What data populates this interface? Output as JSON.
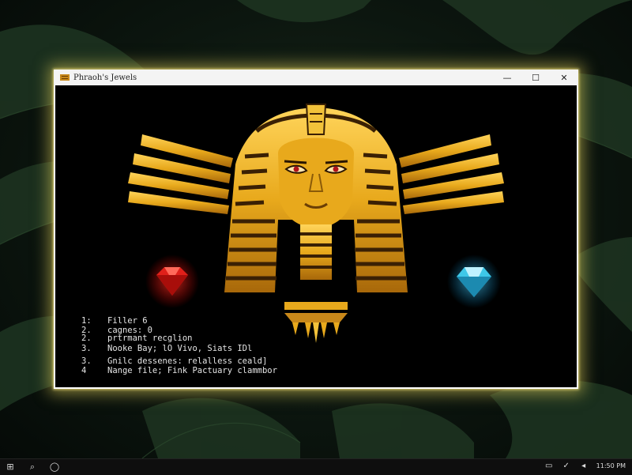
{
  "window": {
    "title": "Phraoh's Jewels",
    "controls": {
      "minimize": "—",
      "maximize": "☐",
      "close": "✕"
    }
  },
  "terminal": {
    "lines": [
      {
        "num": "1:",
        "text": "Filler 6"
      },
      {
        "num": "2.",
        "text": "cagnes: 0"
      },
      {
        "num": "2.",
        "text": "prtrmant recglion"
      },
      {
        "num": "3.",
        "text": "Nooke Bay; lO Vivo, Siats IDl"
      },
      {
        "num": "3.",
        "text": "Gnilc dessenes: relalless ceald]"
      },
      {
        "num": "4",
        "text": "Nange file; Fink Pactuary clammbor"
      }
    ]
  },
  "taskbar": {
    "clock": "11:50 PM"
  },
  "colors": {
    "gold": "#e8a91c",
    "gold_dark": "#8a5a08",
    "ruby": "#e0201a",
    "diamond": "#3ec8e8",
    "window_glow": "#e6d25a"
  },
  "icons": [
    "windows-start-icon",
    "search-icon",
    "task-view-icon",
    "pharaoh-icon",
    "ruby-gem-icon",
    "diamond-gem-icon"
  ]
}
